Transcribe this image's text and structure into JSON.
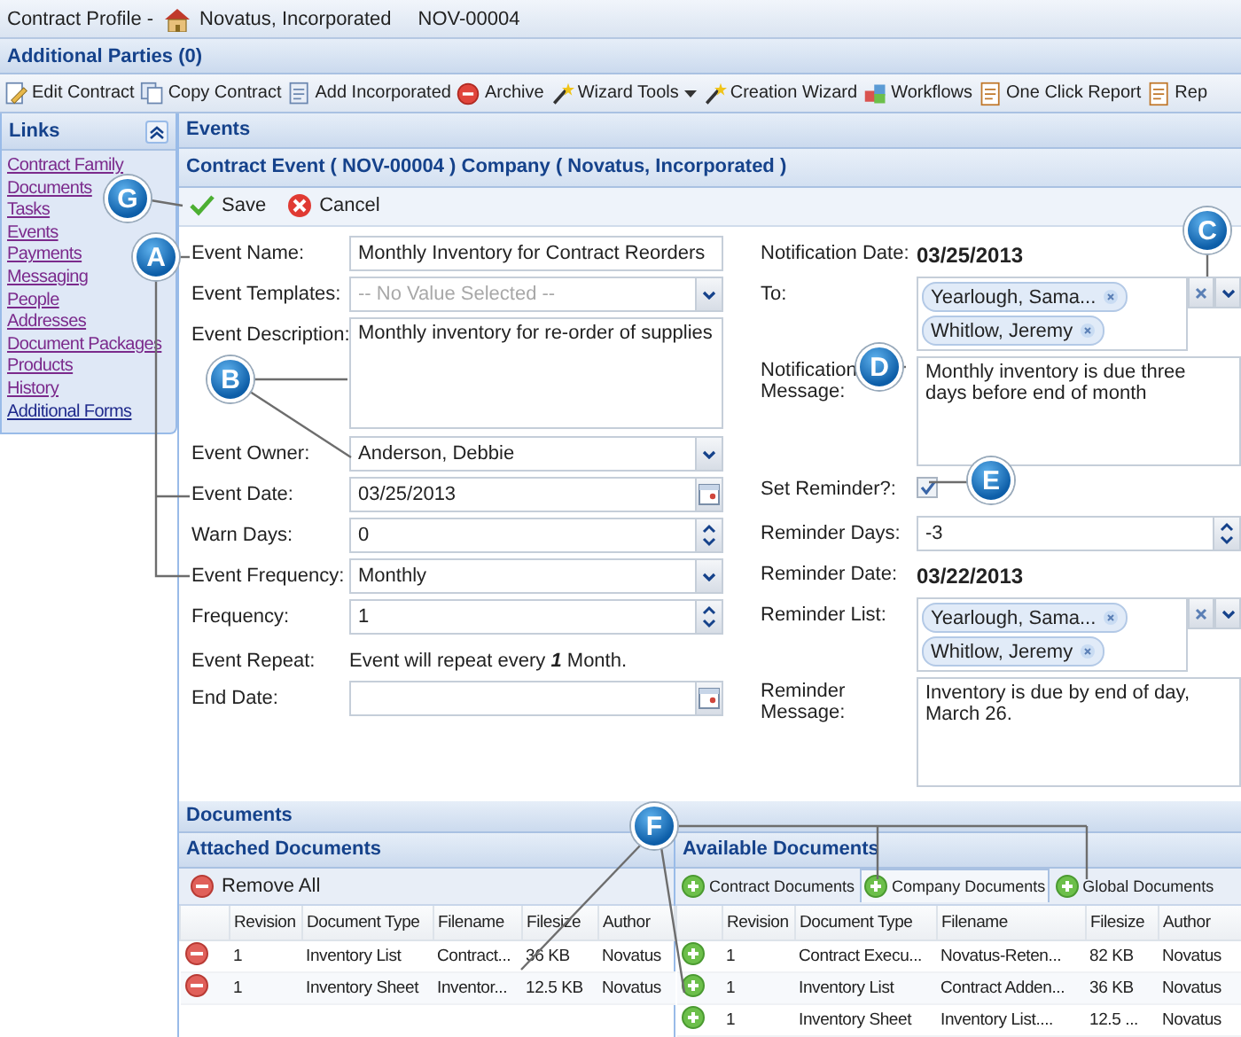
{
  "header": {
    "title": "Contract Profile -",
    "company": "Novatus, Incorporated",
    "contract_id": "NOV-00004"
  },
  "additional_parties": "Additional Parties (0)",
  "toolbar": [
    {
      "label": "Edit Contract",
      "kind": "edit",
      "dropdown": false
    },
    {
      "label": "Copy Contract",
      "kind": "copy",
      "dropdown": false
    },
    {
      "label": "Add Incorporated",
      "kind": "add",
      "dropdown": false
    },
    {
      "label": "Archive",
      "kind": "archive",
      "dropdown": false
    },
    {
      "label": "Wizard Tools",
      "kind": "wizard",
      "dropdown": true
    },
    {
      "label": "Creation Wizard",
      "kind": "wizard",
      "dropdown": false
    },
    {
      "label": "Workflows",
      "kind": "workflow",
      "dropdown": false
    },
    {
      "label": "One Click Report",
      "kind": "report",
      "dropdown": false
    },
    {
      "label": "Rep",
      "kind": "report",
      "dropdown": false
    }
  ],
  "links": {
    "title": "Links",
    "items": [
      {
        "label": "Contract Family",
        "visited": true
      },
      {
        "label": "Documents",
        "visited": true
      },
      {
        "label": "Tasks",
        "visited": true
      },
      {
        "label": "Events",
        "visited": true
      },
      {
        "label": "Payments",
        "visited": true
      },
      {
        "label": "Messaging",
        "visited": true
      },
      {
        "label": "People",
        "visited": true
      },
      {
        "label": "Addresses",
        "visited": true
      },
      {
        "label": "Document Packages",
        "visited": true
      },
      {
        "label": "Products",
        "visited": true
      },
      {
        "label": "History",
        "visited": true
      },
      {
        "label": "Additional Forms",
        "visited": false
      }
    ]
  },
  "events": {
    "title": "Events",
    "subtitle": "Contract Event ( NOV-00004 ) Company ( Novatus, Incorporated )",
    "actions": [
      {
        "label": "Save",
        "kind": "save"
      },
      {
        "label": "Cancel",
        "kind": "cancel"
      }
    ]
  },
  "form_left": [
    {
      "label": "Event Name:",
      "kind": "text",
      "value": "Monthly Inventory for Contract Reorders"
    },
    {
      "label": "Event Templates:",
      "kind": "select",
      "placeholder": "-- No Value Selected --"
    },
    {
      "label": "Event Description:",
      "kind": "textarea",
      "value": "Monthly inventory for re-order of supplies"
    },
    {
      "label": "Event Owner:",
      "kind": "select",
      "value": "Anderson, Debbie"
    },
    {
      "label": "Event Date:",
      "kind": "date",
      "value": "03/25/2013"
    },
    {
      "label": "Warn Days:",
      "kind": "spinner",
      "value": "0"
    },
    {
      "label": "Event Frequency:",
      "kind": "select",
      "value": "Monthly"
    },
    {
      "label": "Frequency:",
      "kind": "spinner",
      "value": "1"
    },
    {
      "label": "Event Repeat:",
      "kind": "static",
      "value": "Event will repeat every **1** Month."
    },
    {
      "label": "End Date:",
      "kind": "date"
    }
  ],
  "form_right": [
    {
      "label": "Notification Date:",
      "kind": "static_bold",
      "value": "03/25/2013"
    },
    {
      "label": "To:",
      "kind": "tags",
      "tags": [
        "Yearlough, Sama...",
        "Whitlow, Jeremy"
      ]
    },
    {
      "label": "Notification Message:",
      "kind": "textarea",
      "value": "Monthly inventory is due three days before end of month"
    },
    {
      "label": "Set Reminder?:",
      "kind": "checkbox",
      "checked": true
    },
    {
      "label": "Reminder Days:",
      "kind": "spinner",
      "value": "-3"
    },
    {
      "label": "Reminder Date:",
      "kind": "static_bold",
      "value": "03/22/2013"
    },
    {
      "label": "Reminder List:",
      "kind": "tags",
      "tags": [
        "Yearlough, Sama...",
        "Whitlow, Jeremy"
      ]
    },
    {
      "label": "Reminder Message:",
      "kind": "textarea",
      "value": "Inventory is due by end of day, March 26."
    }
  ],
  "documents": {
    "title": "Documents",
    "attached": {
      "title": "Attached Documents",
      "action": "Remove All",
      "columns": [
        "Revision",
        "Document Type",
        "Filename",
        "Filesize",
        "Author"
      ],
      "rows": [
        {
          "cells": [
            "1",
            "Inventory List",
            "Contract...",
            "36 KB",
            "Novatus"
          ]
        },
        {
          "cells": [
            "1",
            "Inventory Sheet",
            "Inventor...",
            "12.5 KB",
            "Novatus"
          ]
        }
      ]
    },
    "available": {
      "title": "Available Documents",
      "tabs": [
        {
          "label": "Contract Documents",
          "selected": false
        },
        {
          "label": "Company Documents",
          "selected": true
        },
        {
          "label": "Global Documents",
          "selected": false
        }
      ],
      "columns": [
        "Revision",
        "Document Type",
        "Filename",
        "Filesize",
        "Author"
      ],
      "rows": [
        {
          "cells": [
            "1",
            "Contract Execu...",
            "Novatus-Reten...",
            "82 KB",
            "Novatus"
          ]
        },
        {
          "cells": [
            "1",
            "Inventory List",
            "Contract Adden...",
            "36 KB",
            "Novatus"
          ]
        },
        {
          "cells": [
            "1",
            "Inventory Sheet",
            "Inventory List....",
            "12.5 ...",
            "Novatus"
          ]
        }
      ]
    }
  },
  "callouts": [
    {
      "letter": "G"
    },
    {
      "letter": "A"
    },
    {
      "letter": "B"
    },
    {
      "letter": "C"
    },
    {
      "letter": "D"
    },
    {
      "letter": "E"
    },
    {
      "letter": "F"
    }
  ]
}
